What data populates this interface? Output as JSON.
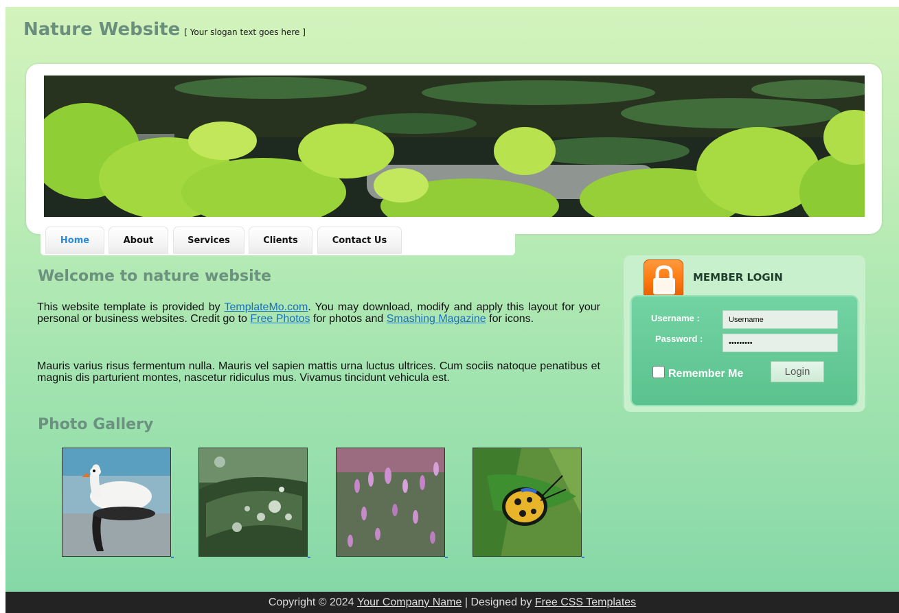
{
  "header": {
    "site_title": "Nature Website",
    "slogan": "[ Your slogan text goes here ]"
  },
  "nav": {
    "tabs": [
      {
        "label": "Home",
        "active": true
      },
      {
        "label": "About",
        "active": false
      },
      {
        "label": "Services",
        "active": false
      },
      {
        "label": "Clients",
        "active": false
      },
      {
        "label": "Contact Us",
        "active": false
      }
    ]
  },
  "content": {
    "welcome_title": "Welcome to nature website",
    "para1": {
      "t1": "This website template is provided by ",
      "link1": "TemplateMo.com",
      "t2": ". You may download, modify and apply this layout for your personal or business websites. Credit go to ",
      "link2": "Free Photos",
      "t3": " for photos and ",
      "link3": "Smashing Magazine",
      "t4": " for icons."
    },
    "para2": "Mauris varius risus fermentum nulla. Mauris vel sapien mattis urna luctus ultrices. Cum sociis natoque penatibus et magnis dis parturient montes, nascetur ridiculus mus. Vivamus tincidunt vehicula est.",
    "gallery_title": "Photo Gallery",
    "gallery": [
      "swan-photo",
      "water-drops-photo",
      "purple-flowers-photo",
      "beetle-photo"
    ]
  },
  "login": {
    "title": "MEMBER LOGIN",
    "username_label": "Username :",
    "password_label": "Password :",
    "username_value": "Username",
    "password_value": "•••••••••",
    "remember_label": "Remember Me",
    "login_button": "Login",
    "icon": "lock-icon"
  },
  "footer": {
    "t1": "Copyright © 2024 ",
    "link1": "Your Company Name",
    "t2": " | Designed by ",
    "link2": "Free CSS Templates"
  },
  "colors": {
    "title": "#6a8f7c",
    "link": "#1a6fbf",
    "active_tab": "#2a8bd6",
    "footer_bg": "#232323",
    "login_panel": "#5ac28e",
    "lock_orange": "#ff7a10"
  }
}
